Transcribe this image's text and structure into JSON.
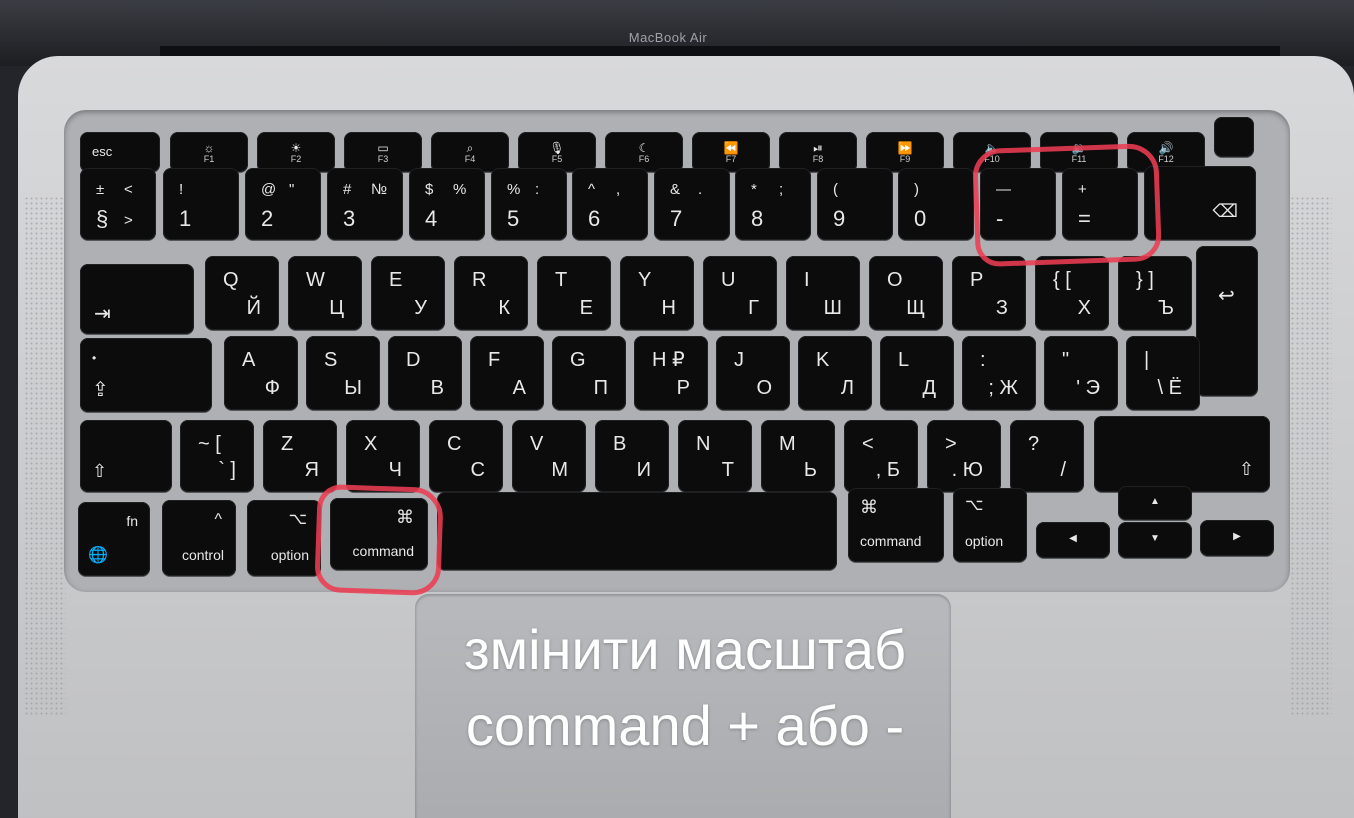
{
  "laptop": {
    "lid_label": "MacBook Air"
  },
  "function_row": {
    "esc": "esc",
    "keys": [
      {
        "name": "brightness-down-icon",
        "icon": "☼",
        "fn": "F1"
      },
      {
        "name": "brightness-up-icon",
        "icon": "☀",
        "fn": "F2"
      },
      {
        "name": "mission-control-icon",
        "icon": "▭",
        "fn": "F3"
      },
      {
        "name": "search-icon",
        "icon": "⌕",
        "fn": "F4"
      },
      {
        "name": "dictation-icon",
        "icon": "🎙",
        "fn": "F5"
      },
      {
        "name": "do-not-disturb-icon",
        "icon": "☾",
        "fn": "F6"
      },
      {
        "name": "rewind-icon",
        "icon": "⏪",
        "fn": "F7"
      },
      {
        "name": "play-pause-icon",
        "icon": "⏯",
        "fn": "F8"
      },
      {
        "name": "fast-forward-icon",
        "icon": "⏩",
        "fn": "F9"
      },
      {
        "name": "mute-icon",
        "icon": "🔈",
        "fn": "F10"
      },
      {
        "name": "volume-down-icon",
        "icon": "🔉",
        "fn": "F11"
      },
      {
        "name": "volume-up-icon",
        "icon": "🔊",
        "fn": "F12"
      }
    ]
  },
  "number_row": [
    {
      "top": "±",
      "top2": "<",
      "bottom": "§",
      "bottom2": ">"
    },
    {
      "top": "!",
      "top2": "",
      "bottom": "1",
      "bottom2": ""
    },
    {
      "top": "@",
      "top2": "\"",
      "bottom": "2",
      "bottom2": ""
    },
    {
      "top": "#",
      "top2": "№",
      "bottom": "3",
      "bottom2": ""
    },
    {
      "top": "$",
      "top2": "%",
      "bottom": "4",
      "bottom2": ""
    },
    {
      "top": "%",
      "top2": ":",
      "bottom": "5",
      "bottom2": ""
    },
    {
      "top": "^",
      "top2": ",",
      "bottom": "6",
      "bottom2": ""
    },
    {
      "top": "&",
      "top2": ".",
      "bottom": "7",
      "bottom2": ""
    },
    {
      "top": "*",
      "top2": ";",
      "bottom": "8",
      "bottom2": ""
    },
    {
      "top": "(",
      "top2": "",
      "bottom": "9",
      "bottom2": ""
    },
    {
      "top": ")",
      "top2": "",
      "bottom": "0",
      "bottom2": ""
    },
    {
      "top": "—",
      "top2": "",
      "bottom": "-",
      "bottom2": ""
    },
    {
      "top": "+",
      "top2": "",
      "bottom": "=",
      "bottom2": ""
    }
  ],
  "letter_rows": {
    "row1": [
      {
        "lat": "Q",
        "cyr": "Й"
      },
      {
        "lat": "W",
        "cyr": "Ц"
      },
      {
        "lat": "E",
        "cyr": "У"
      },
      {
        "lat": "R",
        "cyr": "К"
      },
      {
        "lat": "T",
        "cyr": "Е"
      },
      {
        "lat": "Y",
        "cyr": "Н"
      },
      {
        "lat": "U",
        "cyr": "Г"
      },
      {
        "lat": "I",
        "cyr": "Ш"
      },
      {
        "lat": "O",
        "cyr": "Щ"
      },
      {
        "lat": "P",
        "cyr": "З"
      },
      {
        "lat": "{ [",
        "cyr": "Х"
      },
      {
        "lat": "} ]",
        "cyr": "Ъ"
      }
    ],
    "row2": [
      {
        "lat": "A",
        "cyr": "Ф"
      },
      {
        "lat": "S",
        "cyr": "Ы"
      },
      {
        "lat": "D",
        "cyr": "В"
      },
      {
        "lat": "F",
        "cyr": "А"
      },
      {
        "lat": "G",
        "cyr": "П"
      },
      {
        "lat": "H ₽",
        "cyr": "Р"
      },
      {
        "lat": "J",
        "cyr": "О"
      },
      {
        "lat": "K",
        "cyr": "Л"
      },
      {
        "lat": "L",
        "cyr": "Д"
      },
      {
        "lat": ":",
        "cyr": "; Ж"
      },
      {
        "lat": "\"",
        "cyr": "' Э"
      },
      {
        "lat": "|",
        "cyr": "\\ Ё"
      }
    ],
    "row3": [
      {
        "lat": "~ [",
        "cyr": "` ]"
      },
      {
        "lat": "Z",
        "cyr": "Я"
      },
      {
        "lat": "X",
        "cyr": "Ч"
      },
      {
        "lat": "C",
        "cyr": "С"
      },
      {
        "lat": "V",
        "cyr": "М"
      },
      {
        "lat": "B",
        "cyr": "И"
      },
      {
        "lat": "N",
        "cyr": "Т"
      },
      {
        "lat": "M",
        "cyr": "Ь"
      },
      {
        "lat": "<",
        "cyr": ", Б"
      },
      {
        "lat": ">",
        "cyr": ". Ю"
      },
      {
        "lat": "?",
        "cyr": "/"
      }
    ]
  },
  "modifiers": {
    "tab": "⇥",
    "caps_dot": "•",
    "caps": "⇪",
    "shift": "⇧",
    "return": "↩",
    "delete": "⌫",
    "fn": "fn",
    "globe": "🌐",
    "control_symbol": "^",
    "control": "control",
    "option_symbol": "⌥",
    "option": "option",
    "command_symbol": "⌘",
    "command": "command"
  },
  "arrows": {
    "up": "▲",
    "down": "▼",
    "left": "◀",
    "right": "▶"
  },
  "annotation": {
    "line1": "змінити масштаб",
    "line2": "command + або -",
    "mark_color": "#ec3c52"
  }
}
